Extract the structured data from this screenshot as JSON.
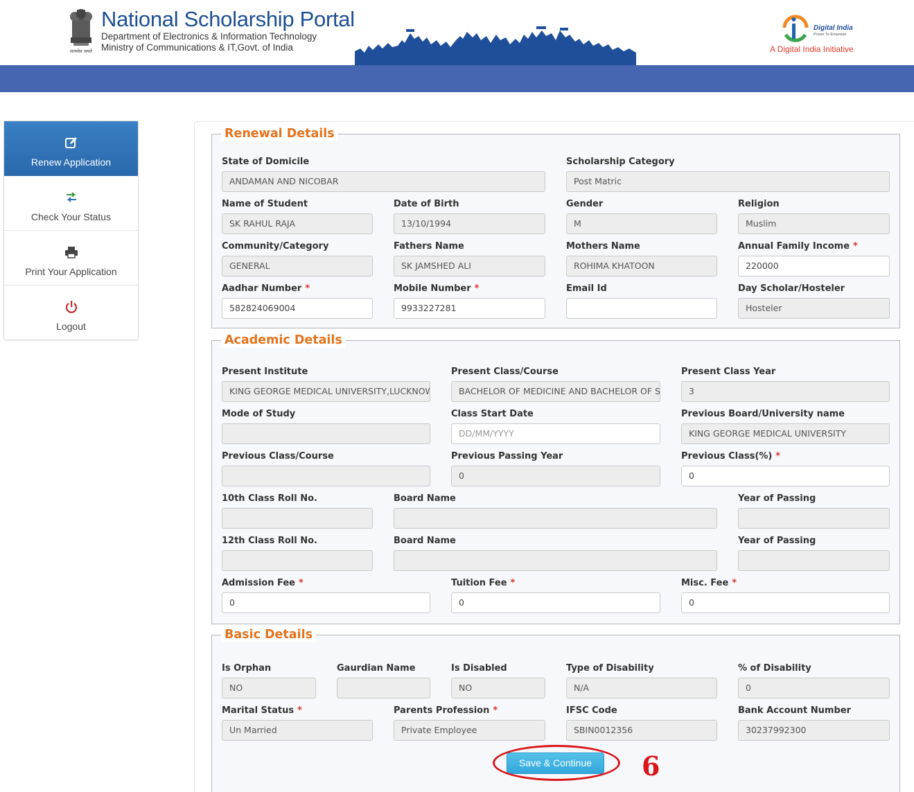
{
  "header": {
    "title": "National Scholarship Portal",
    "dept": "Department of Electronics & Information Technology",
    "ministry": "Ministry of Communications & IT,Govt. of India",
    "di_brand": "Digital India",
    "di_slogan": "Power To Empower",
    "di_tagline": "A Digital India Initiative",
    "emblem_caption": "सत्यमेव जयते"
  },
  "sidebar": {
    "items": [
      {
        "label": "Renew Application",
        "icon": "edit-icon"
      },
      {
        "label": "Check Your Status",
        "icon": "transfer-arrows-icon"
      },
      {
        "label": "Print Your Application",
        "icon": "printer-icon"
      },
      {
        "label": "Logout",
        "icon": "power-icon"
      }
    ]
  },
  "renewal": {
    "title": "Renewal Details",
    "state_label": "State of Domicile",
    "state_value": "ANDAMAN AND NICOBAR",
    "category_label": "Scholarship Category",
    "category_value": "Post Matric",
    "name_label": "Name of Student",
    "name_value": "SK RAHUL RAJA",
    "dob_label": "Date of Birth",
    "dob_value": "13/10/1994",
    "gender_label": "Gender",
    "gender_value": "M",
    "religion_label": "Religion",
    "religion_value": "Muslim",
    "community_label": "Community/Category",
    "community_value": "GENERAL",
    "father_label": "Fathers Name",
    "father_value": "SK JAMSHED ALI",
    "mother_label": "Mothers Name",
    "mother_value": "ROHIMA KHATOON",
    "income_label": "Annual Family Income",
    "income_value": "220000",
    "aadhar_label": "Aadhar Number",
    "aadhar_value": "582824069004",
    "mobile_label": "Mobile Number",
    "mobile_value": "9933227281",
    "email_label": "Email Id",
    "email_value": "",
    "scholar_label": "Day Scholar/Hosteler",
    "scholar_value": "Hosteler"
  },
  "academic": {
    "title": "Academic Details",
    "institute_label": "Present Institute",
    "institute_value": "KING GEORGE MEDICAL UNIVERSITY,LUCKNOW",
    "course_label": "Present Class/Course",
    "course_value": "BACHELOR OF MEDICINE AND BACHELOR OF SURGERY",
    "class_year_label": "Present Class Year",
    "class_year_value": "3",
    "mode_label": "Mode of Study",
    "mode_value": "",
    "start_label": "Class Start Date",
    "start_placeholder": "DD/MM/YYYY",
    "prev_board_label": "Previous Board/University name",
    "prev_board_value": "KING GEORGE MEDICAL UNIVERSITY",
    "prev_course_label": "Previous Class/Course",
    "prev_course_value": "",
    "prev_year_label": "Previous Passing Year",
    "prev_year_value": "0",
    "prev_pct_label": "Previous Class(%)",
    "prev_pct_value": "0",
    "roll10_label": "10th Class Roll No.",
    "roll10_value": "",
    "board10_label": "Board Name",
    "board10_value": "",
    "year10_label": "Year of Passing",
    "year10_value": "",
    "roll12_label": "12th Class Roll No.",
    "roll12_value": "",
    "board12_label": "Board Name",
    "board12_value": "",
    "year12_label": "Year of Passing",
    "year12_value": "",
    "admission_label": "Admission Fee",
    "admission_value": "0",
    "tuition_label": "Tuition Fee",
    "tuition_value": "0",
    "misc_label": "Misc. Fee",
    "misc_value": "0"
  },
  "basic": {
    "title": "Basic Details",
    "orphan_label": "Is Orphan",
    "orphan_value": "NO",
    "guardian_label": "Gaurdian Name",
    "guardian_value": "",
    "disabled_label": "Is Disabled",
    "disabled_value": "NO",
    "disability_type_label": "Type of Disability",
    "disability_type_value": "N/A",
    "disability_pct_label": "% of Disability",
    "disability_pct_value": "0",
    "marital_label": "Marital Status",
    "marital_value": "Un Married",
    "profession_label": "Parents Profession",
    "profession_value": "Private Employee",
    "ifsc_label": "IFSC Code",
    "ifsc_value": "SBIN0012356",
    "account_label": "Bank Account Number",
    "account_value": "30237992300"
  },
  "actions": {
    "save_label": "Save & Continue",
    "step_number": "6"
  },
  "colors": {
    "header_band": "#4766b1",
    "section_title": "#e3731c",
    "required": "#d9342b",
    "highlight": "#d9161a",
    "button": "#32a7dc"
  }
}
